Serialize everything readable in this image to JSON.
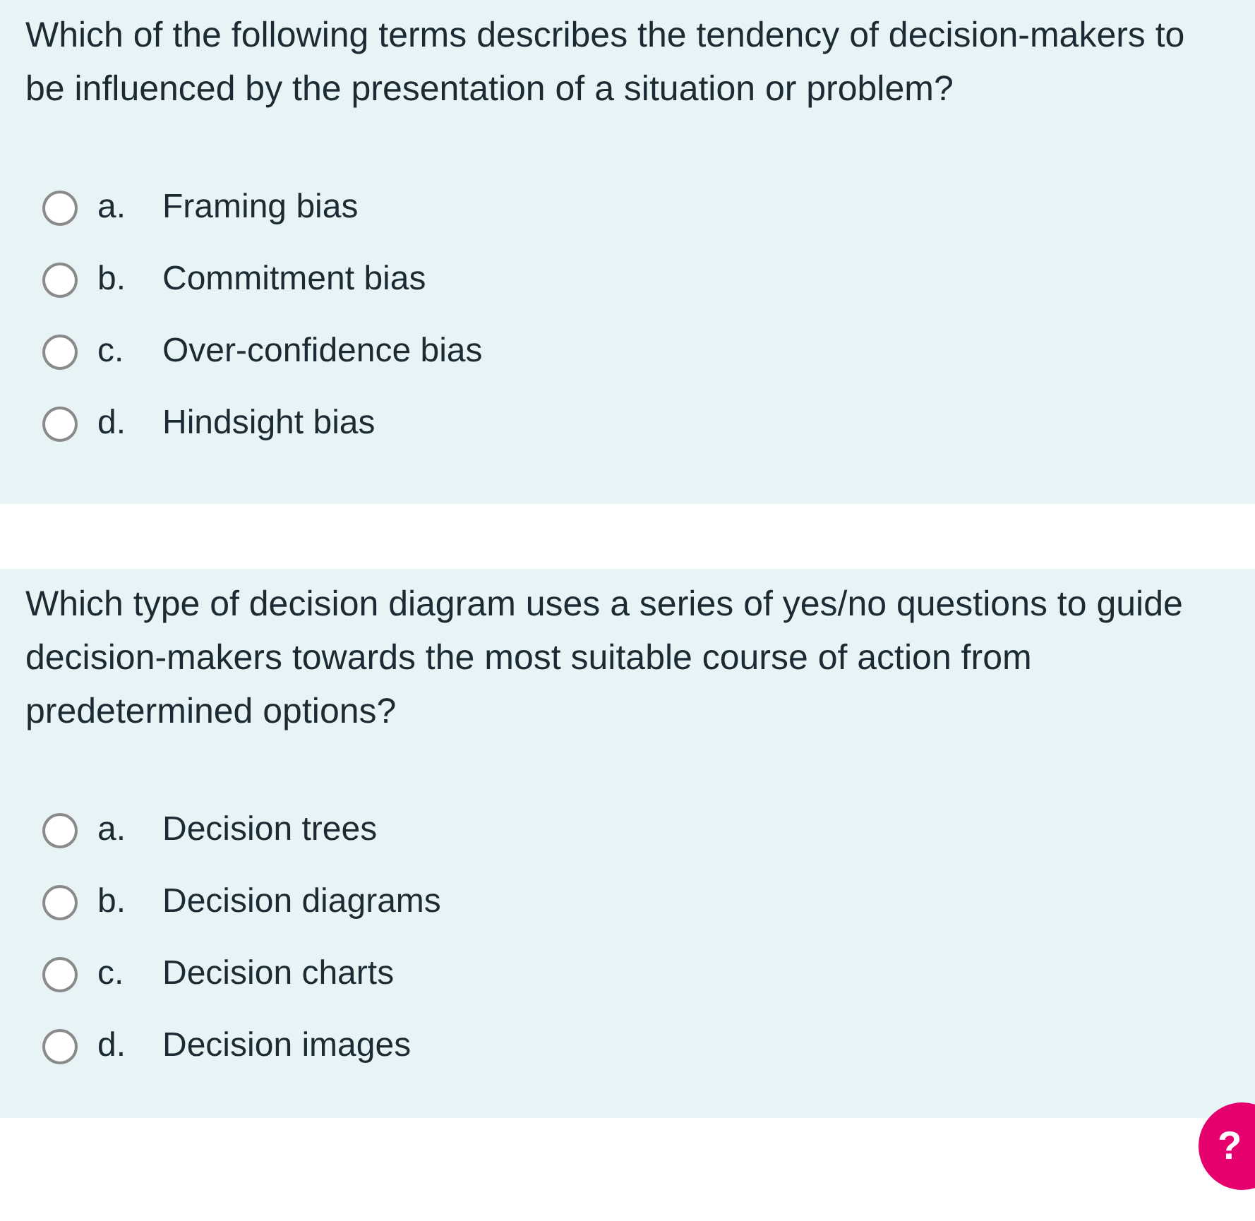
{
  "questions": [
    {
      "text": "Which of the following terms describes the tendency of decision-makers to be influenced by the presentation of a situation or problem?",
      "options": [
        {
          "letter": "a.",
          "label": "Framing bias",
          "selected": false
        },
        {
          "letter": "b.",
          "label": "Commitment bias",
          "selected": false
        },
        {
          "letter": "c.",
          "label": "Over-confidence bias",
          "selected": false
        },
        {
          "letter": "d.",
          "label": "Hindsight bias",
          "selected": false
        }
      ]
    },
    {
      "text": "Which type of decision diagram uses a series of yes/no questions to guide decision-makers towards the most suitable course of action from predetermined options?",
      "options": [
        {
          "letter": "a.",
          "label": "Decision trees",
          "selected": false
        },
        {
          "letter": "b.",
          "label": "Decision diagrams",
          "selected": false
        },
        {
          "letter": "c.",
          "label": "Decision charts",
          "selected": false
        },
        {
          "letter": "d.",
          "label": "Decision images",
          "selected": false
        }
      ]
    }
  ],
  "help_button": {
    "label": "?"
  }
}
